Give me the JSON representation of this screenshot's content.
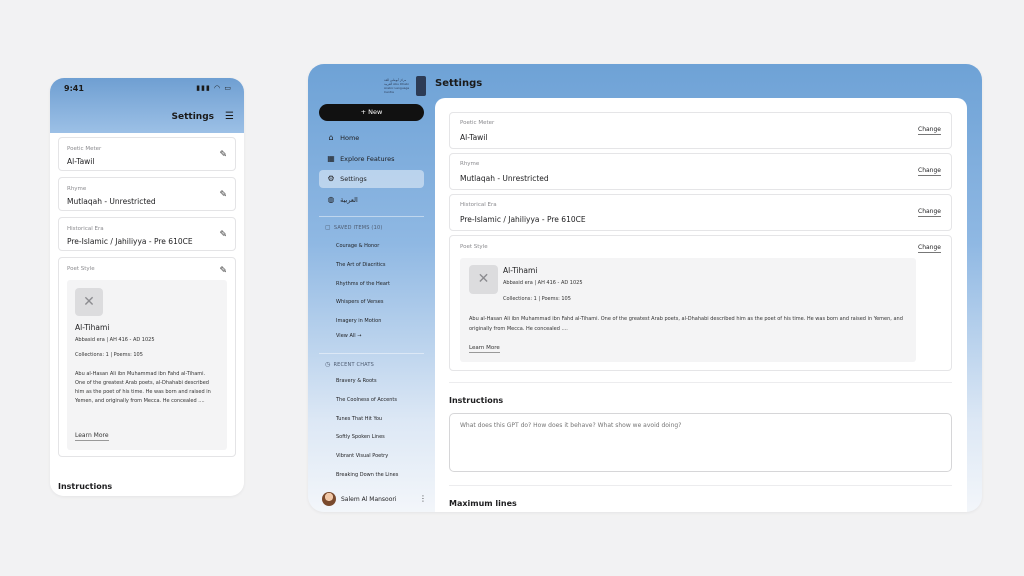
{
  "phone": {
    "status": {
      "time": "9:41",
      "icons": "▮▮▮ ◠ ▭"
    },
    "title": "Settings",
    "menu_icon": "☰",
    "fields": [
      {
        "label": "Poetic Meter",
        "value": "Al-Tawil"
      },
      {
        "label": "Rhyme",
        "value": "Mutlaqah - Unrestricted"
      },
      {
        "label": "Historical Era",
        "value": "Pre-Islamic / Jahiliyya - Pre 610CE"
      }
    ],
    "poet_style": {
      "label": "Poet Style",
      "name": "Al-Tihami",
      "meta": "Abbasid era  |  AH 416 - AD 1025",
      "stats": "Collections: 1  |  Poems: 105",
      "bio": "Abu al-Hasan Ali ibn Muhammad ibn Fahd al-Tihami. One of the greatest Arab poets, al-Dhahabi described him as the poet of his time. He was born and raised in Yemen, and originally from Mecca. He concealed ....",
      "learn_more": "Learn More"
    },
    "instructions_heading": "Instructions"
  },
  "app": {
    "logo_text": "مركز أبوظبي للغة العربية Abu Dhabi Arabic Language Centre",
    "title": "Settings",
    "sidebar": {
      "new_button": "+  New",
      "nav": [
        {
          "icon": "⌂",
          "label": "Home"
        },
        {
          "icon": "▦",
          "label": "Explore Features"
        },
        {
          "icon": "⚙",
          "label": "Settings"
        },
        {
          "icon": "◍",
          "label": "العربية"
        }
      ],
      "saved_heading": "SAVED ITEMS (10)",
      "saved_items": [
        "Courage & Honor",
        "The Art of Diacritics",
        "Rhythms of the Heart",
        "Whispers of Verses",
        "Imagery in Motion"
      ],
      "view_all": "View All  →",
      "recent_heading": "RECENT CHATS",
      "recent_chats": [
        "Bravery & Roots",
        "The Coolness of Accents",
        "Tunes That Hit You",
        "Softly Spoken Lines",
        "Vibrant Visual Poetry",
        "Breaking Down the Lines"
      ],
      "user_name": "Salem Al Mansoori",
      "user_more": "⋮"
    },
    "fields": [
      {
        "label": "Poetic Meter",
        "value": "Al-Tawil",
        "action": "Change"
      },
      {
        "label": "Rhyme",
        "value": "Mutlaqah - Unrestricted",
        "action": "Change"
      },
      {
        "label": "Historical Era",
        "value": "Pre-Islamic / Jahiliyya - Pre 610CE",
        "action": "Change"
      }
    ],
    "poet_style": {
      "label": "Poet Style",
      "action": "Change",
      "name": "Al-Tihami",
      "meta": "Abbasid era  |  AH 416 - AD 1025",
      "stats": "Collections: 1  |  Poems: 105",
      "bio": "Abu al-Hasan Ali ibn Muhammad ibn Fahd al-Tihami. One of the greatest Arab poets, al-Dhahabi described him as the poet of his time. He was born and raised in Yemen, and originally from Mecca. He concealed ....",
      "learn_more": "Learn More"
    },
    "instructions_heading": "Instructions",
    "instructions_placeholder": "What does this GPT do? How does it behave? What show we avoid doing?",
    "max_lines_heading": "Maximum lines"
  }
}
